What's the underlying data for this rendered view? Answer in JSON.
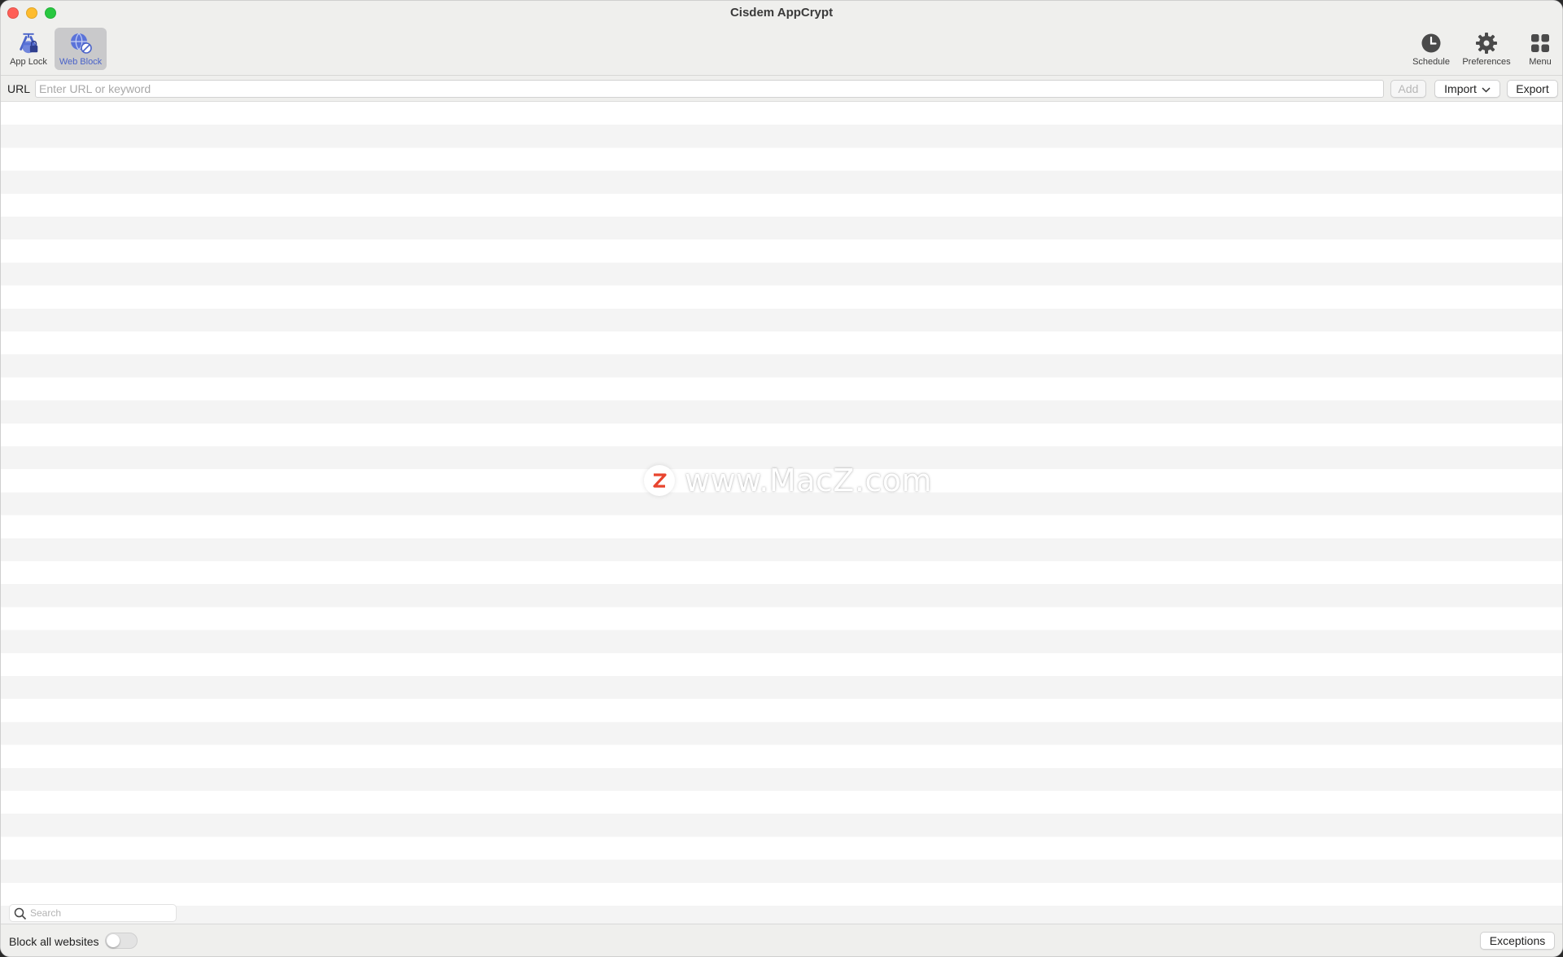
{
  "window": {
    "title": "Cisdem AppCrypt"
  },
  "toolbar": {
    "app_lock_label": "App Lock",
    "web_block_label": "Web Block",
    "schedule_label": "Schedule",
    "preferences_label": "Preferences",
    "menu_label": "Menu",
    "active_tab": "web_block",
    "accent_color": "#4a63c9"
  },
  "url_bar": {
    "label": "URL",
    "placeholder": "Enter URL or keyword",
    "value": "",
    "add_label": "Add",
    "import_label": "Import",
    "export_label": "Export"
  },
  "list": {
    "search_placeholder": "Search",
    "items": []
  },
  "watermark": {
    "text": "www.MacZ.com",
    "badge": "Z",
    "badge_color": "#e8442e"
  },
  "footer": {
    "block_all_label": "Block all websites",
    "block_all_on": false,
    "exceptions_label": "Exceptions"
  }
}
